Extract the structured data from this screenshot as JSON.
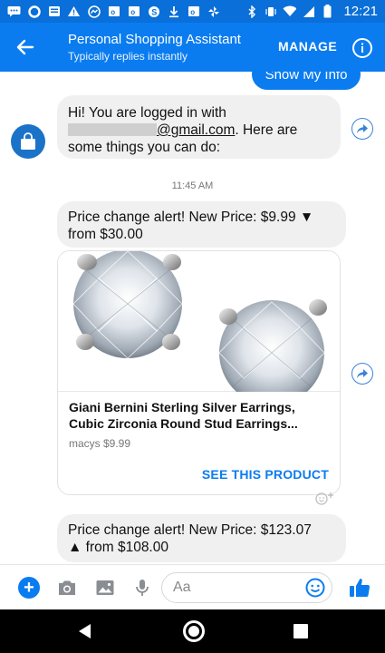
{
  "status_bar": {
    "time": "12:21",
    "icons": [
      "messenger-icon",
      "circle-icon",
      "news-icon",
      "warning-icon",
      "messenger-icon",
      "outlook-icon",
      "outlook-icon",
      "skype-icon",
      "download-icon",
      "outlook-icon",
      "pinwheel-icon",
      "bluetooth-icon",
      "vibrate-icon",
      "wifi-icon",
      "signal-icon",
      "battery-icon"
    ]
  },
  "header": {
    "title": "Personal Shopping Assistant",
    "subtitle": "Typically replies instantly",
    "manage_label": "MANAGE"
  },
  "conversation": {
    "outgoing_button": "Show My Info",
    "login_message": {
      "line1": "Hi! You are logged in with",
      "email_domain": "@gmail.com",
      "line2_tail": ". Here are",
      "line3": "some things you can do:"
    },
    "timestamp": "11:45 AM",
    "alert1": {
      "text_line1": "Price change alert! New Price: $9.99 ▼",
      "text_line2": "from $30.00"
    },
    "product_card": {
      "title": "Giani Bernini Sterling Silver Earrings, Cubic Zirconia Round Stud Earrings...",
      "subtitle": "macys $9.99",
      "action": "SEE THIS PRODUCT"
    },
    "alert2": {
      "text_line1": "Price change alert! New Price: $123.07",
      "text_line2": "▲ from $108.00"
    }
  },
  "composer": {
    "placeholder": "Aa"
  },
  "colors": {
    "brand_blue": "#0a7cf0",
    "status_blue": "#0a6fd8",
    "bubble_gray": "#f1f0f0"
  }
}
